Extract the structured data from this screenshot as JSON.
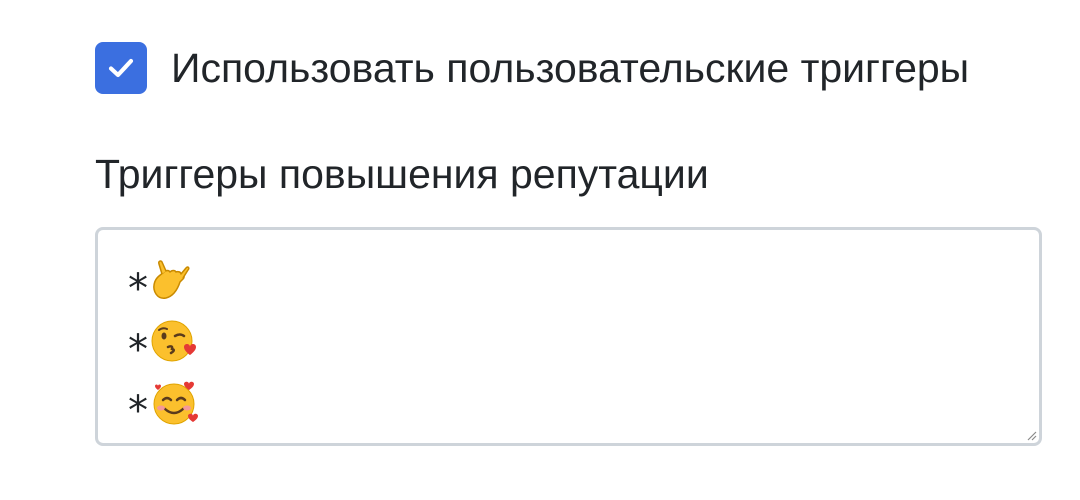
{
  "custom_triggers": {
    "checked": true,
    "label": "Использовать пользовательские триггеры"
  },
  "reputation_up": {
    "label": "Триггеры повышения репутации",
    "lines": [
      {
        "prefix": "*",
        "emoji": "call-me-hand-icon"
      },
      {
        "prefix": "*",
        "emoji": "face-blowing-kiss-icon"
      },
      {
        "prefix": "*",
        "emoji": "smiling-face-with-hearts-icon"
      }
    ]
  },
  "colors": {
    "checkbox_bg": "#3b6fe0",
    "text": "#212529",
    "border": "#ced4da"
  }
}
